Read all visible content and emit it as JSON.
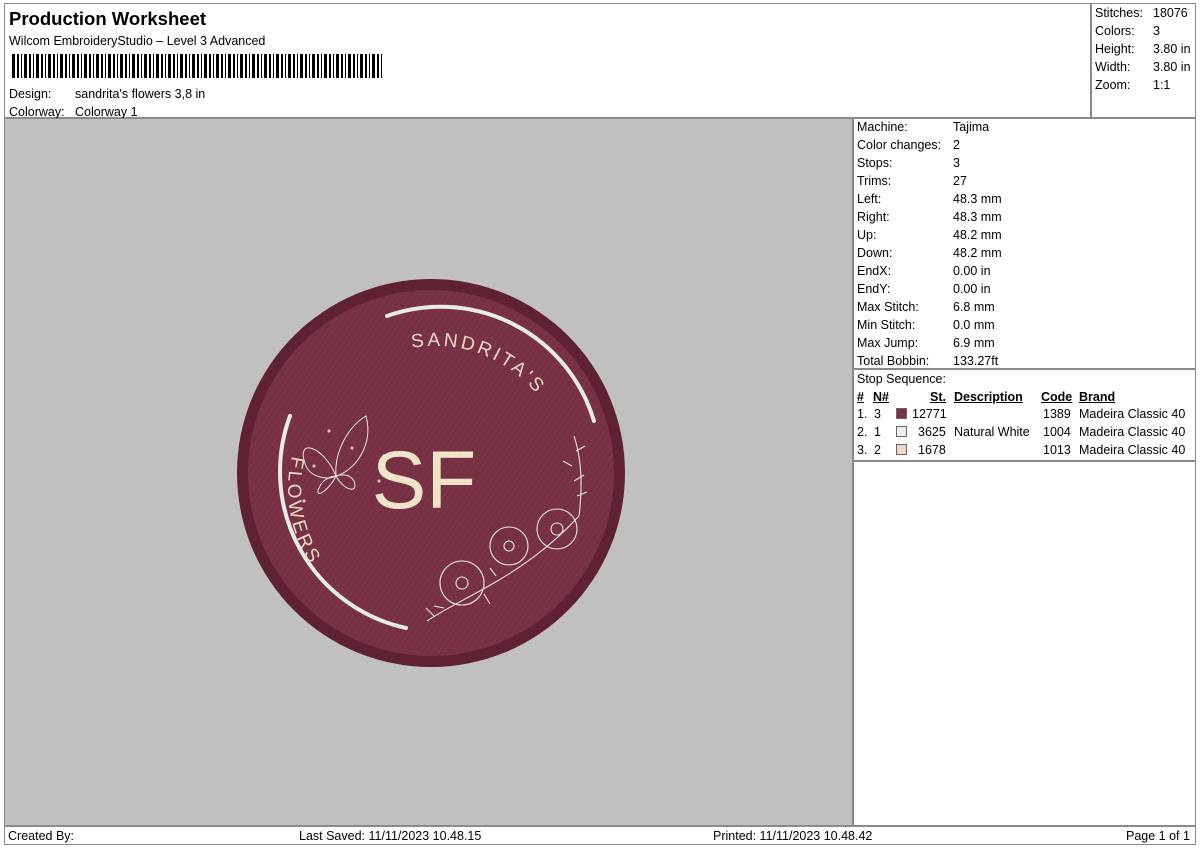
{
  "header": {
    "title": "Production Worksheet",
    "subtitle": "Wilcom EmbroideryStudio – Level 3 Advanced",
    "design_label": "Design:",
    "design_value": "sandrita's flowers 3,8 in",
    "colorway_label": "Colorway:",
    "colorway_value": "Colorway 1"
  },
  "stats": [
    {
      "label": "Stitches:",
      "value": "18076"
    },
    {
      "label": "Colors:",
      "value": "3"
    },
    {
      "label": "Height:",
      "value": "3.80 in"
    },
    {
      "label": "Width:",
      "value": "3.80 in"
    },
    {
      "label": "Zoom:",
      "value": "1:1"
    }
  ],
  "machine": [
    {
      "label": "Machine:",
      "value": "Tajima"
    },
    {
      "label": "Color changes:",
      "value": "2"
    },
    {
      "label": "Stops:",
      "value": "3"
    },
    {
      "label": "Trims:",
      "value": "27"
    },
    {
      "label": "Left:",
      "value": "48.3 mm"
    },
    {
      "label": "Right:",
      "value": "48.3 mm"
    },
    {
      "label": "Up:",
      "value": "48.2 mm"
    },
    {
      "label": "Down:",
      "value": "48.2 mm"
    },
    {
      "label": "EndX:",
      "value": "0.00 in"
    },
    {
      "label": "EndY:",
      "value": "0.00 in"
    },
    {
      "label": "Max Stitch:",
      "value": "6.8 mm"
    },
    {
      "label": "Min Stitch:",
      "value": "0.0 mm"
    },
    {
      "label": "Max Jump:",
      "value": "6.9 mm"
    },
    {
      "label": "Total Bobbin:",
      "value": "133.27ft"
    }
  ],
  "stop_sequence": {
    "title": "Stop Sequence:",
    "headers": {
      "index": "#",
      "needle": "N#",
      "stitches": "St.",
      "description": "Description",
      "code": "Code",
      "brand": "Brand"
    },
    "rows": [
      {
        "index": "1.",
        "needle": "3",
        "color": "#7a3346",
        "stitches": "12771",
        "description": "",
        "code": "1389",
        "brand": "Madeira Classic 40"
      },
      {
        "index": "2.",
        "needle": "1",
        "color": "#eeeef2",
        "stitches": "3625",
        "description": "Natural White",
        "code": "1004",
        "brand": "Madeira Classic 40"
      },
      {
        "index": "3.",
        "needle": "2",
        "color": "#f2d8cc",
        "stitches": "1678",
        "description": "",
        "code": "1013",
        "brand": "Madeira Classic 40"
      }
    ]
  },
  "design_preview": {
    "background_color": "#c0c0c0",
    "patch_color": "#7a3346",
    "thread_light": "#f0e6d8",
    "monogram": "SF",
    "arc_text_top": "SANDRITA'S",
    "arc_text_left": "FLOWERS"
  },
  "footer": {
    "created_by": "Created By:",
    "last_saved": "Last Saved: 11/11/2023 10.48.15",
    "printed": "Printed: 11/11/2023 10.48.42",
    "page": "Page 1 of 1"
  }
}
